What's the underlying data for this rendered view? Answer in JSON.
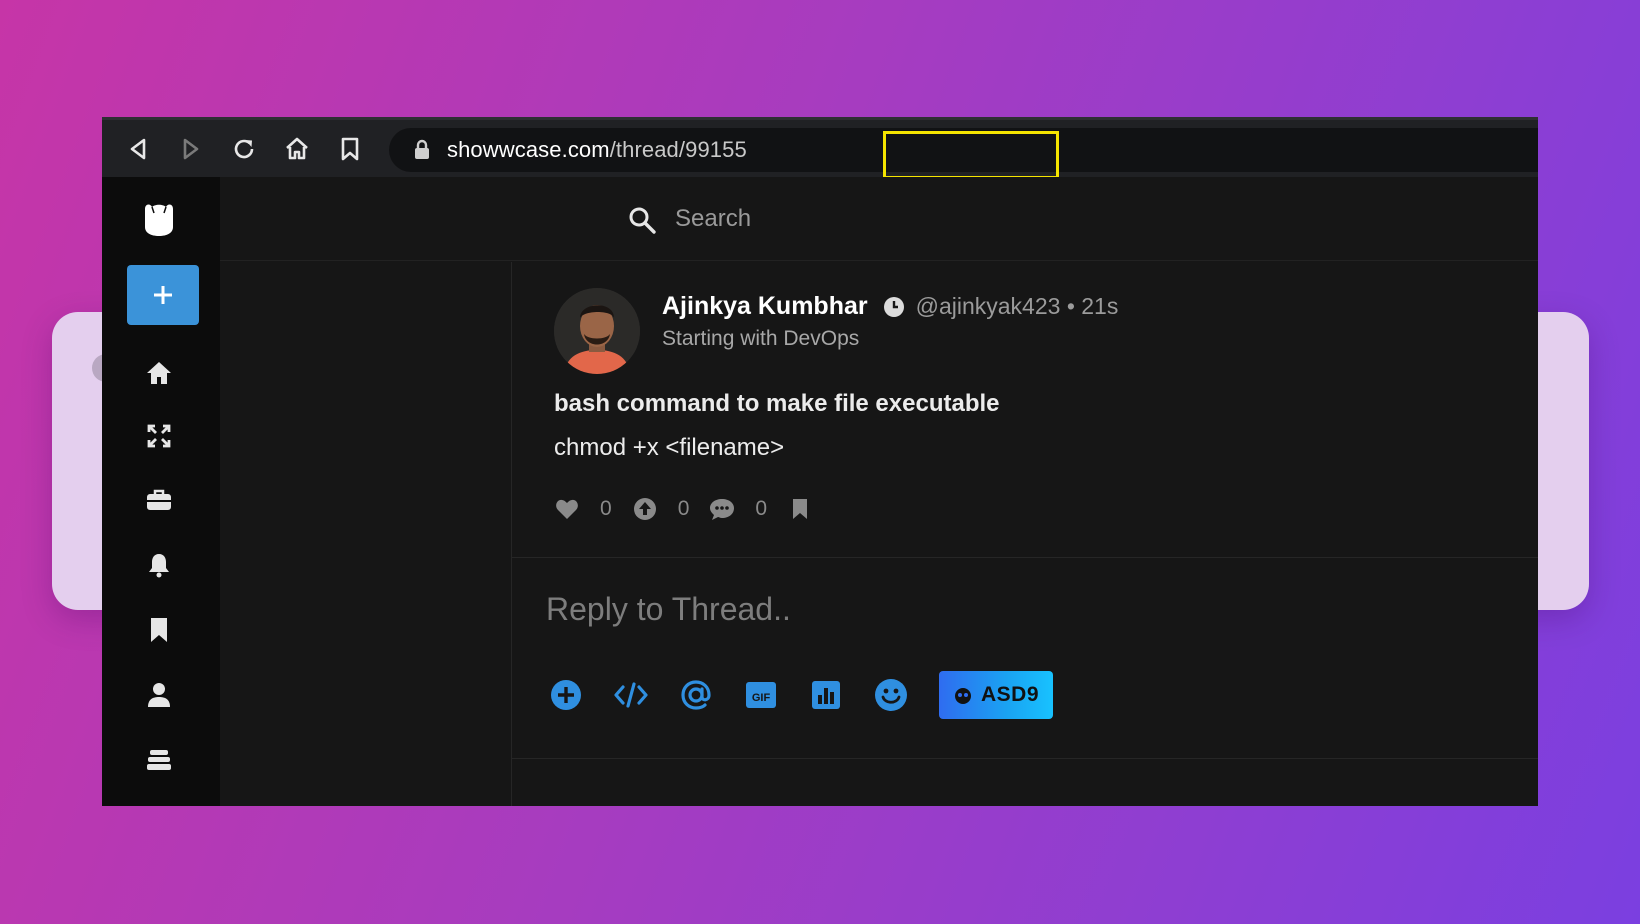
{
  "browser": {
    "url_host": "showwcase.com",
    "url_path": "/thread/99155"
  },
  "search": {
    "placeholder": "Search"
  },
  "post": {
    "author_name": "Ajinkya Kumbhar",
    "handle_time": "@ajinkyak423 • 21s",
    "subtitle": "Starting with DevOps",
    "title": "bash command to make file executable",
    "body": "chmod +x <filename>",
    "likes": "0",
    "boosts": "0",
    "comments": "0"
  },
  "reply": {
    "placeholder": "Reply to Thread..",
    "asd9_label": "ASD9"
  },
  "colors": {
    "accent": "#3b93d9",
    "highlight_box": "#f5e400",
    "background_gradient_start": "#c635a7",
    "background_gradient_end": "#7b3fe0"
  }
}
